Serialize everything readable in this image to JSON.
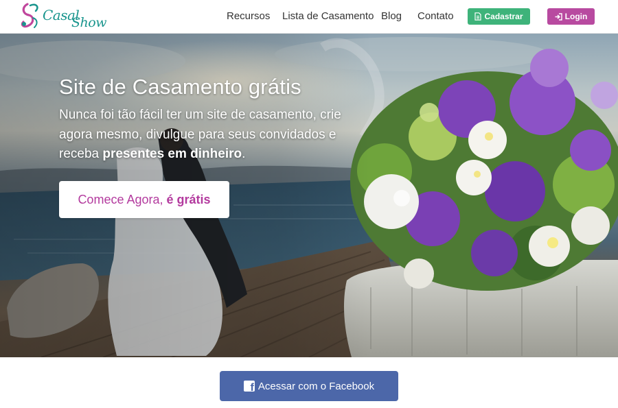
{
  "brand": {
    "name_part1": "Casal",
    "name_part2": "Show",
    "color": "#19958d"
  },
  "nav": {
    "items": [
      {
        "label": "Recursos"
      },
      {
        "label": "Lista de Casamento"
      },
      {
        "label": "Blog"
      },
      {
        "label": "Contato"
      }
    ],
    "cadastrar_label": "Cadastrar",
    "cadastrar_icon": "document-icon",
    "login_label": "Login",
    "login_icon": "sign-in-icon"
  },
  "hero": {
    "title": "Site de Casamento grátis",
    "text_part1": "Nunca foi tão fácil ter um site de casamento, crie agora mesmo, divulgue para seus convidados e receba ",
    "text_bold": "presentes em dinheiro",
    "text_end": ".",
    "cta_label": "Comece Agora,",
    "cta_bold": "é grátis"
  },
  "facebook": {
    "label": "Acessar com o Facebook",
    "icon": "facebook-icon"
  },
  "colors": {
    "green": "#3eb37a",
    "magenta": "#b84aa0",
    "cta_text": "#b33a9e",
    "facebook": "#4c67a9"
  }
}
